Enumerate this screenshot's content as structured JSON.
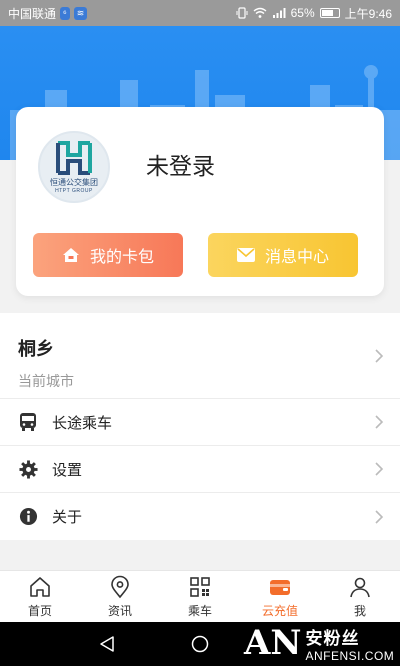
{
  "status_bar": {
    "carrier": "中国联通",
    "badge1": "⁶",
    "badge2": "≋",
    "battery": "65%",
    "time": "上午9:46"
  },
  "profile": {
    "logo_brand": "恒通公交集团",
    "logo_brand_en": "HTPT GROUP",
    "login_status": "未登录",
    "wallet_button": "我的卡包",
    "message_button": "消息中心"
  },
  "city": {
    "name": "桐乡",
    "subtitle": "当前城市"
  },
  "menu": [
    {
      "label": "长途乘车",
      "icon": "bus-icon"
    },
    {
      "label": "设置",
      "icon": "gear-icon"
    },
    {
      "label": "关于",
      "icon": "info-icon"
    }
  ],
  "tabs": [
    {
      "label": "首页",
      "icon": "home-icon",
      "active": false
    },
    {
      "label": "资讯",
      "icon": "location-icon",
      "active": false
    },
    {
      "label": "乘车",
      "icon": "qr-icon",
      "active": false
    },
    {
      "label": "云充值",
      "icon": "wallet-icon",
      "active": true
    },
    {
      "label": "我",
      "icon": "user-icon",
      "active": false
    }
  ],
  "watermark": {
    "logo": "AN",
    "cn": "安粉丝",
    "en": "ANFENSI.COM"
  },
  "colors": {
    "header_blue": "#2a8ff2",
    "active_tab": "#f36d2b",
    "wallet_btn": "#f77858",
    "message_btn": "#f8c532"
  }
}
